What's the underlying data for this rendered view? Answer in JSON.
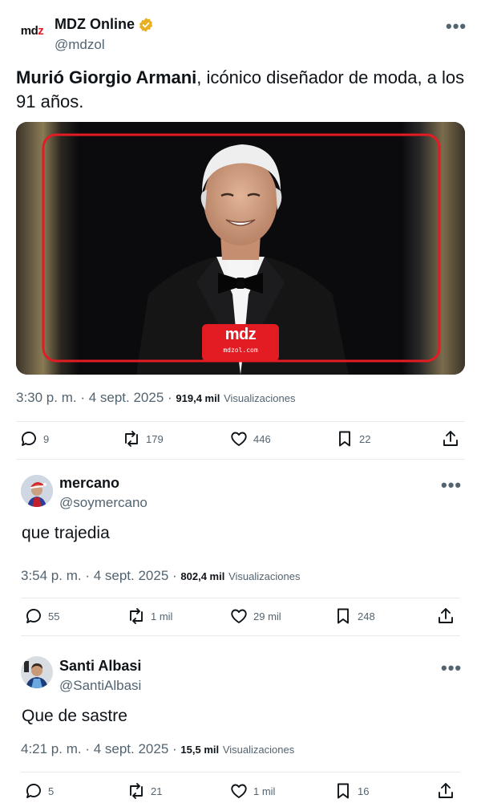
{
  "tweets": [
    {
      "name": "MDZ Online",
      "handle": "@mdzol",
      "verified": true,
      "logo_text": "mdz",
      "text_bold": "Murió Giorgio Armani",
      "text_rest": ", icónico diseñador de moda, a los 91 años.",
      "media_logo": "mdz",
      "media_logo_sub": "mdzol.com",
      "time": "3:30 p. m. · 4 sept. 2025 ·",
      "views": "919,4 mil",
      "views_label": "Visualizaciones",
      "replies": "9",
      "retweets": "179",
      "likes": "446",
      "bookmarks": "22"
    },
    {
      "name": "mercano",
      "handle": "@soymercano",
      "text": "que trajedia",
      "time": "3:54 p. m. · 4 sept. 2025 ·",
      "views": "802,4 mil",
      "views_label": "Visualizaciones",
      "replies": "55",
      "retweets": "1 mil",
      "likes": "29 mil",
      "bookmarks": "248"
    },
    {
      "name": "Santi Albasi",
      "handle": "@SantiAlbasi",
      "text": "Que de sastre",
      "time": "4:21 p. m. · 4 sept. 2025 ·",
      "views": "15,5 mil",
      "views_label": "Visualizaciones",
      "replies": "5",
      "retweets": "21",
      "likes": "1 mil",
      "bookmarks": "16"
    }
  ],
  "more_label": "•••",
  "colors": {
    "accent": "#e31b23",
    "verified": "#e8b020",
    "muted": "#536471"
  },
  "icons": [
    "reply-icon",
    "retweet-icon",
    "like-icon",
    "bookmark-icon",
    "share-icon",
    "verified-badge-icon",
    "more-icon"
  ]
}
